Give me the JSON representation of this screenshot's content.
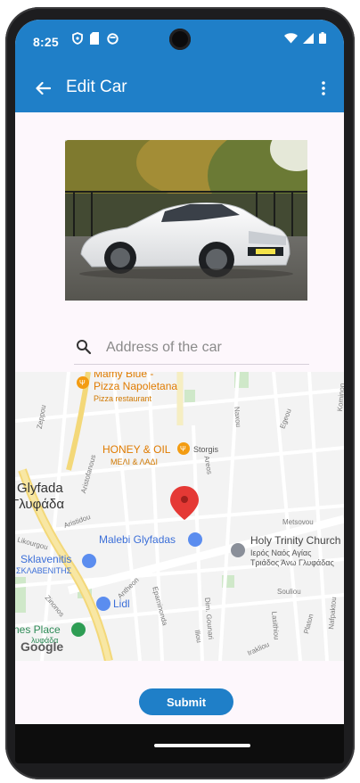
{
  "status_bar": {
    "time": "8:25",
    "left_icons": [
      "shield-icon",
      "sim-card-icon",
      "circle-status-icon"
    ],
    "right_icons": [
      "wifi-icon",
      "signal-icon",
      "battery-icon"
    ]
  },
  "app_bar": {
    "title": "Edit Car",
    "back_icon": "arrow-left-icon",
    "menu_icon": "more-vert-icon",
    "color": "#1f7fc8"
  },
  "car_image": {
    "alt": "White BMW car photo"
  },
  "search": {
    "placeholder": "Address of the car",
    "value": ""
  },
  "map": {
    "places": {
      "pizza_title": "Mamy Blue -",
      "pizza_title2": "Pizza Napoletana",
      "pizza_sub": "Pizza restaurant",
      "honey_title": "HONEY & OIL",
      "honey_sub": "ΜΕΛΙ & ΛΑΔΙ",
      "storgis": "Storgis",
      "glyfada": "Glyfada",
      "glyfada_greek": "Γλυφάδα",
      "malebi": "Malebi Glyfadas",
      "holy": "Holy Trinity Church",
      "holy_greek1": "Ιερός Ναός Αγίας",
      "holy_greek2": "Τριάδος Άνω Γλυφάδας",
      "sklavenitis": "Sklavenitis",
      "sklavenitis_greek": "ΣΚΛΑΒΕΝΙΤΗΣ",
      "lidl": "Lidl",
      "nes_place": "nes Place",
      "nes_place_greek": "λυφάδα",
      "google": "Google"
    },
    "streets": [
      "Zeppou",
      "Aristofanous",
      "Aristidou",
      "Likourgou",
      "Zinonos",
      "Antheon",
      "Epaminonda",
      "Iliou",
      "Dim. Gounari",
      "Naxou",
      "Egeou",
      "Areos",
      "Metsovou",
      "Souliou",
      "Lasithiou",
      "Platon",
      "Nafpaktou",
      "Irakliou",
      "Kominon"
    ]
  },
  "submit": {
    "label": "Submit"
  }
}
